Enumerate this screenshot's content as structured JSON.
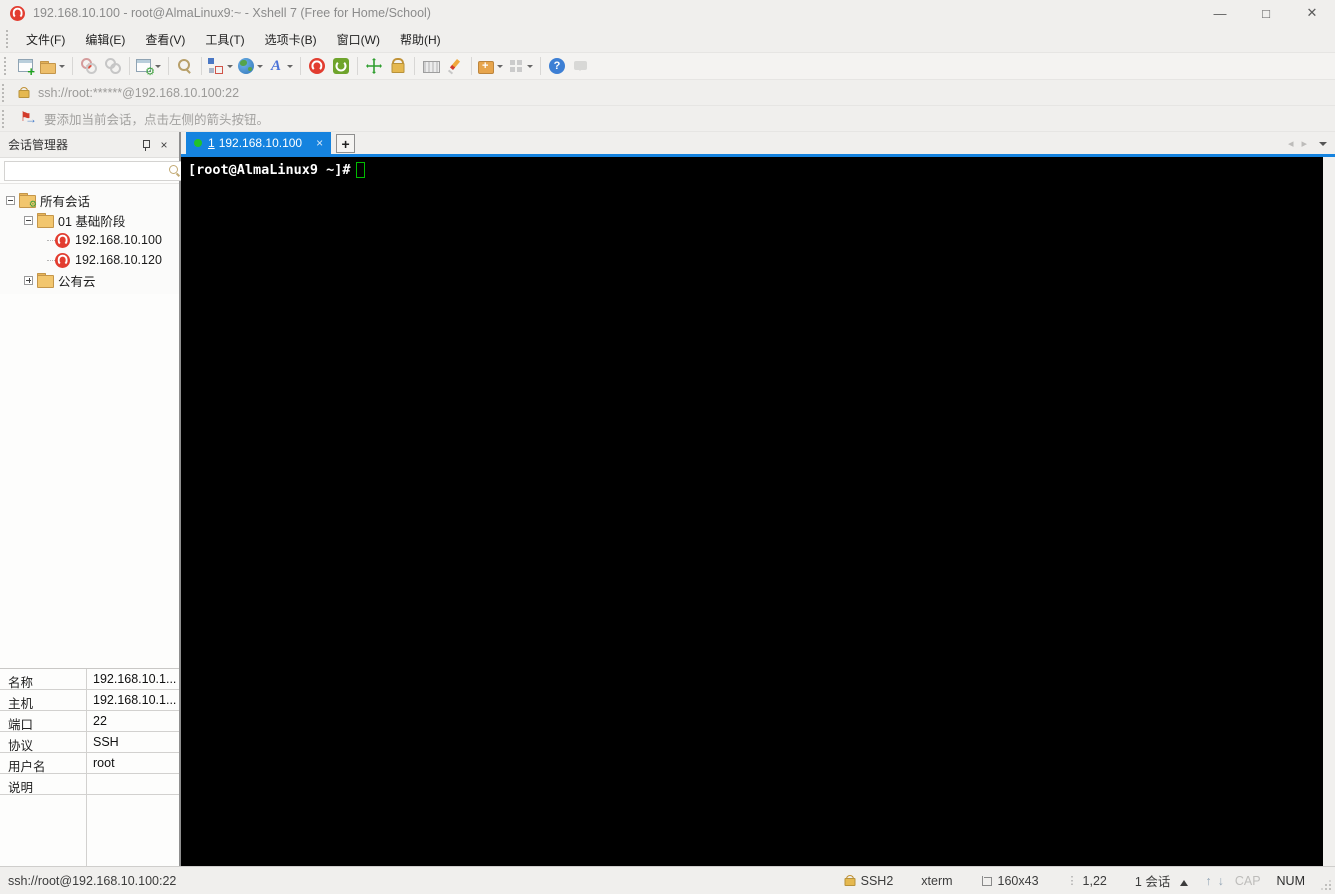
{
  "window": {
    "title": "192.168.10.100 - root@AlmaLinux9:~ - Xshell 7 (Free for Home/School)",
    "minimize": "—",
    "maximize": "□",
    "close": "✕"
  },
  "menu": {
    "items": [
      "文件(F)",
      "编辑(E)",
      "查看(V)",
      "工具(T)",
      "选项卡(B)",
      "窗口(W)",
      "帮助(H)"
    ]
  },
  "toolbar": {
    "icons": [
      "new-session",
      "open-folder",
      "disconnect",
      "reconnect",
      "session-properties",
      "find",
      "arrange-windows",
      "open-in-browser",
      "font-settings",
      "xshell",
      "xftp",
      "fullscreen",
      "lock-screen",
      "virtual-keyboard",
      "highlight-pen",
      "new-folder",
      "tile-windows",
      "help",
      "feedback"
    ]
  },
  "address_bar": {
    "url": "ssh://root:******@192.168.10.100:22"
  },
  "hint_bar": {
    "text": "要添加当前会话，点击左侧的箭头按钮。"
  },
  "session_manager": {
    "title": "会话管理器",
    "search_value": "",
    "tree": {
      "root": "所有会话",
      "folder1": "01 基础阶段",
      "session1": "192.168.10.100",
      "session2": "192.168.10.120",
      "folder2": "公有云"
    },
    "properties": {
      "rows": [
        {
          "label": "名称",
          "value": "192.168.10.1..."
        },
        {
          "label": "主机",
          "value": "192.168.10.1..."
        },
        {
          "label": "端口",
          "value": "22"
        },
        {
          "label": "协议",
          "value": "SSH"
        },
        {
          "label": "用户名",
          "value": "root"
        },
        {
          "label": "说明",
          "value": ""
        }
      ]
    }
  },
  "tab_bar": {
    "active_tab": {
      "number": "1",
      "title": "192.168.10.100",
      "close": "×"
    },
    "new_tab": "+",
    "scroll_left": "◂",
    "scroll_right": "▸"
  },
  "terminal": {
    "prompt": "[root@AlmaLinux9 ~]#"
  },
  "status_bar": {
    "connection": "ssh://root@192.168.10.100:22",
    "protocol": "SSH2",
    "terminal_type": "xterm",
    "size": "160x43",
    "cursor_position": "1,22",
    "session_count": "1 会话",
    "caps_lock": "CAP",
    "num_lock": "NUM"
  }
}
